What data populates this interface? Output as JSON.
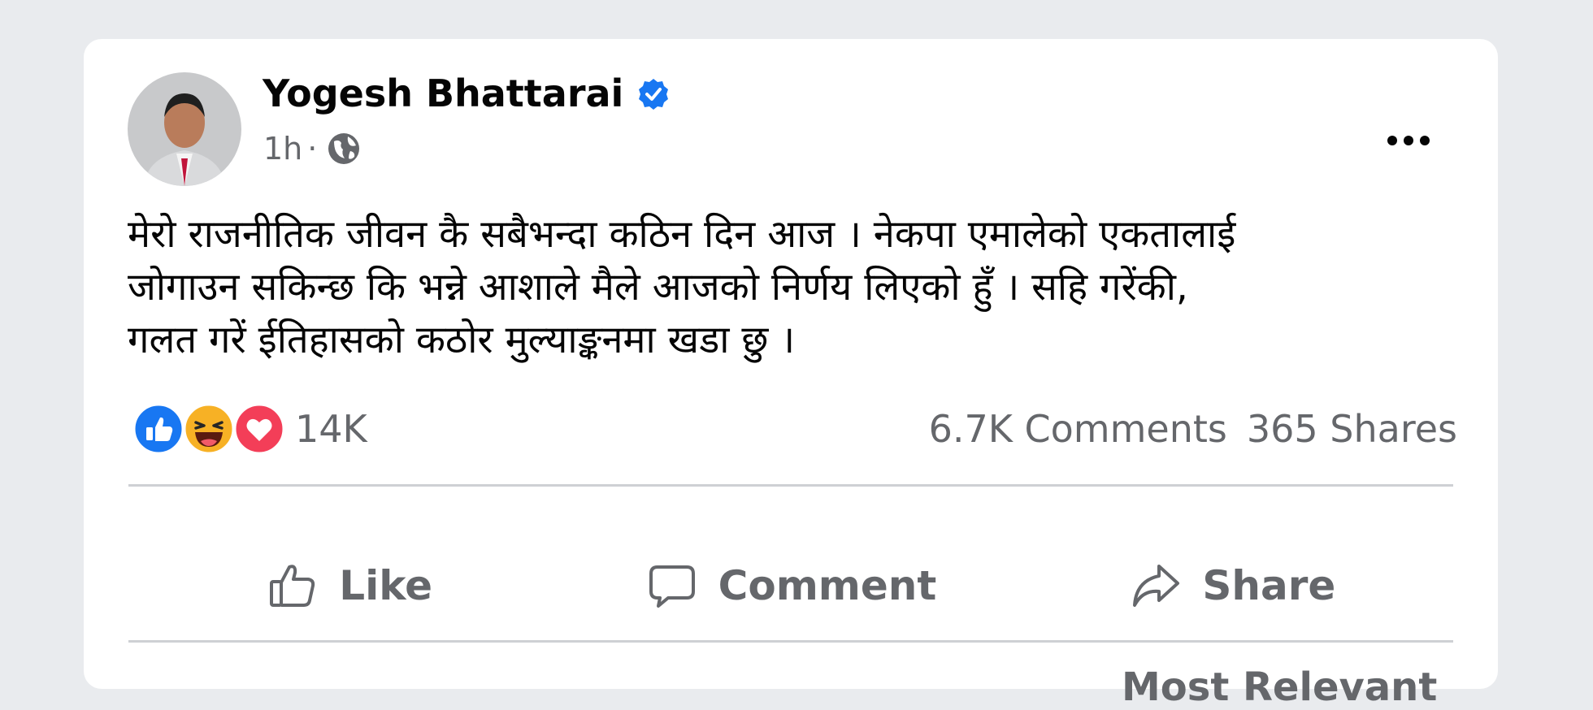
{
  "post": {
    "author": "Yogesh Bhattarai",
    "time": "1h",
    "separator": "·",
    "text": "मेरो राजनीतिक जीवन कै सबैभन्दा कठिन दिन आज । नेकपा एमालेको एकतालाई\nजोगाउन सकिन्छ कि भन्ने आशाले मैले आजको निर्णय लिएको हुँ । सहि गरेंकी,\nगलत गरें ईतिहासको कठोर मुल्याङ्कनमा खडा छु ।",
    "reactions": {
      "icons": [
        "like-reaction-icon",
        "haha-reaction-icon",
        "love-reaction-icon"
      ],
      "count": "14K"
    },
    "comments": "6.7K Comments",
    "shares": "365 Shares"
  },
  "actions": {
    "like": "Like",
    "comment": "Comment",
    "share": "Share"
  },
  "comments_sort": "Most Relevant",
  "colors": {
    "background": "#e9ebee",
    "card": "#ffffff",
    "verified": "#1877f2",
    "secondary_text": "#65676b",
    "like_blue": "#1877f2",
    "love_red": "#f33e58",
    "haha_yellow": "#f7b125"
  }
}
